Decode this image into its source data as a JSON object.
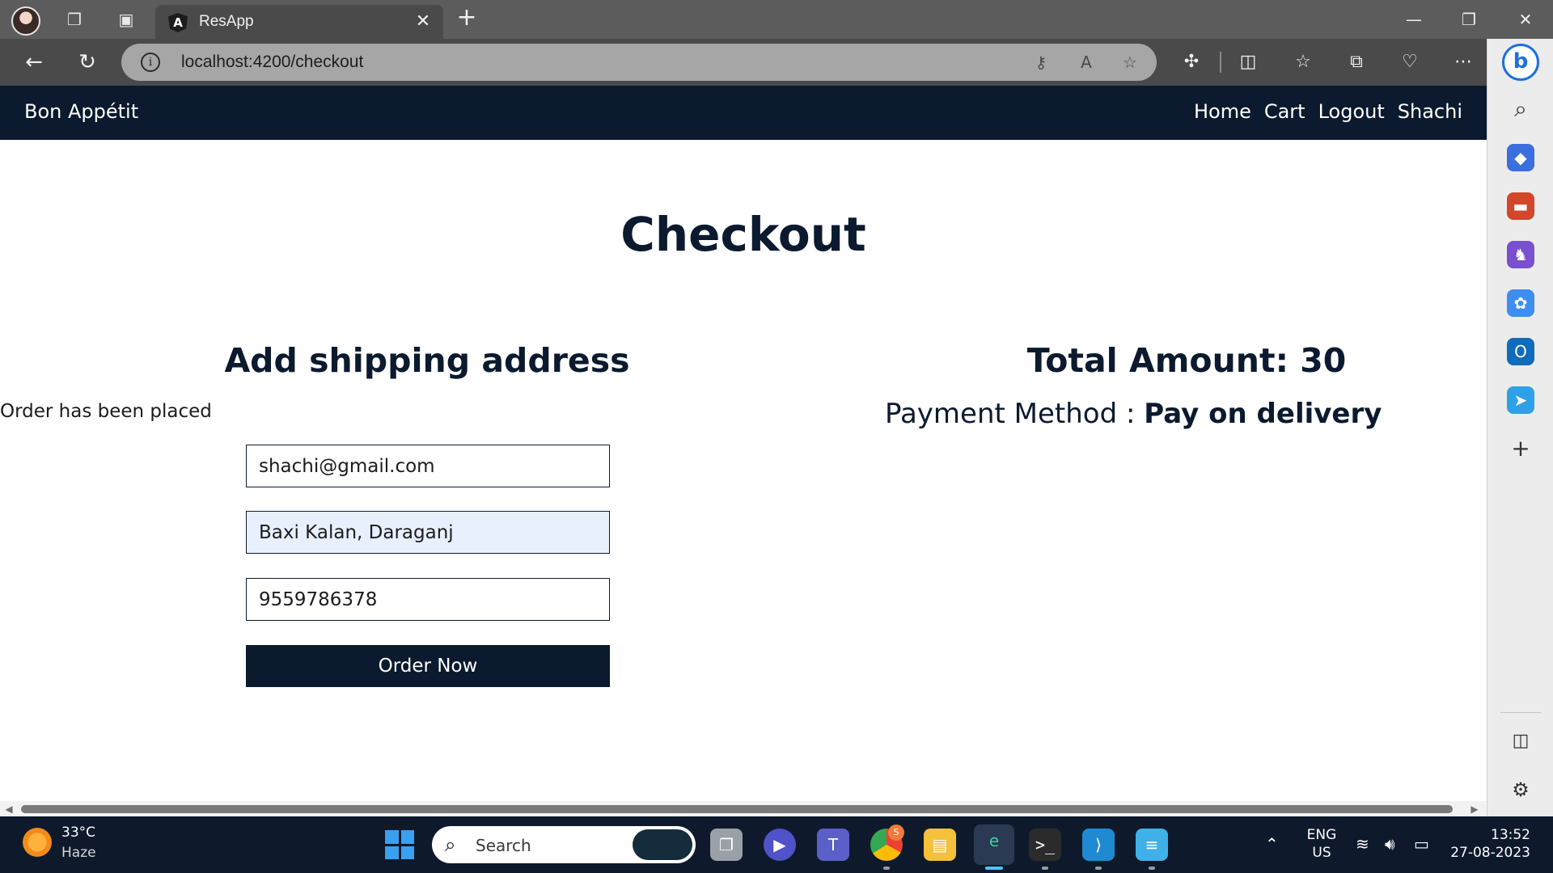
{
  "browser": {
    "tab_title": "ResApp",
    "url": "localhost:4200/checkout",
    "tab_close_glyph": "✕",
    "new_tab_glyph": "+"
  },
  "app": {
    "brand": "Bon Appétit",
    "nav": [
      "Home",
      "Cart",
      "Logout",
      "Shachi"
    ]
  },
  "checkout": {
    "title": "Checkout",
    "shipping_heading": "Add shipping address",
    "order_message": "Order has been placed",
    "fields": {
      "email": "shachi@gmail.com",
      "address": "Baxi Kalan, Daraganj",
      "phone": "9559786378"
    },
    "order_button": "Order Now",
    "total_label": "Total Amount: 30",
    "payment_label": "Payment Method : ",
    "payment_value": "Pay on delivery"
  },
  "taskbar": {
    "weather_temp": "33°C",
    "weather_desc": "Haze",
    "search_label": "Search",
    "lang_line1": "ENG",
    "lang_line2": "US",
    "time": "13:52",
    "date": "27-08-2023",
    "chrome_badge": "S"
  },
  "icons": {
    "back": "back-arrow-icon",
    "refresh": "refresh-icon",
    "info": "site-info-icon",
    "favorite": "star-icon",
    "read_aloud": "read-aloud-icon",
    "extensions": "puzzle-icon",
    "split": "split-screen-icon",
    "favorites": "favorites-icon",
    "collections": "collections-icon",
    "performance": "heart-pulse-icon",
    "more": "more-icon",
    "bing": "bing-copilot-icon"
  },
  "colors": {
    "navbar": "#0b1a2e",
    "button": "#0b1a2e",
    "autofill": "#e8f0fe",
    "accent_blue": "#1c6fe0"
  }
}
